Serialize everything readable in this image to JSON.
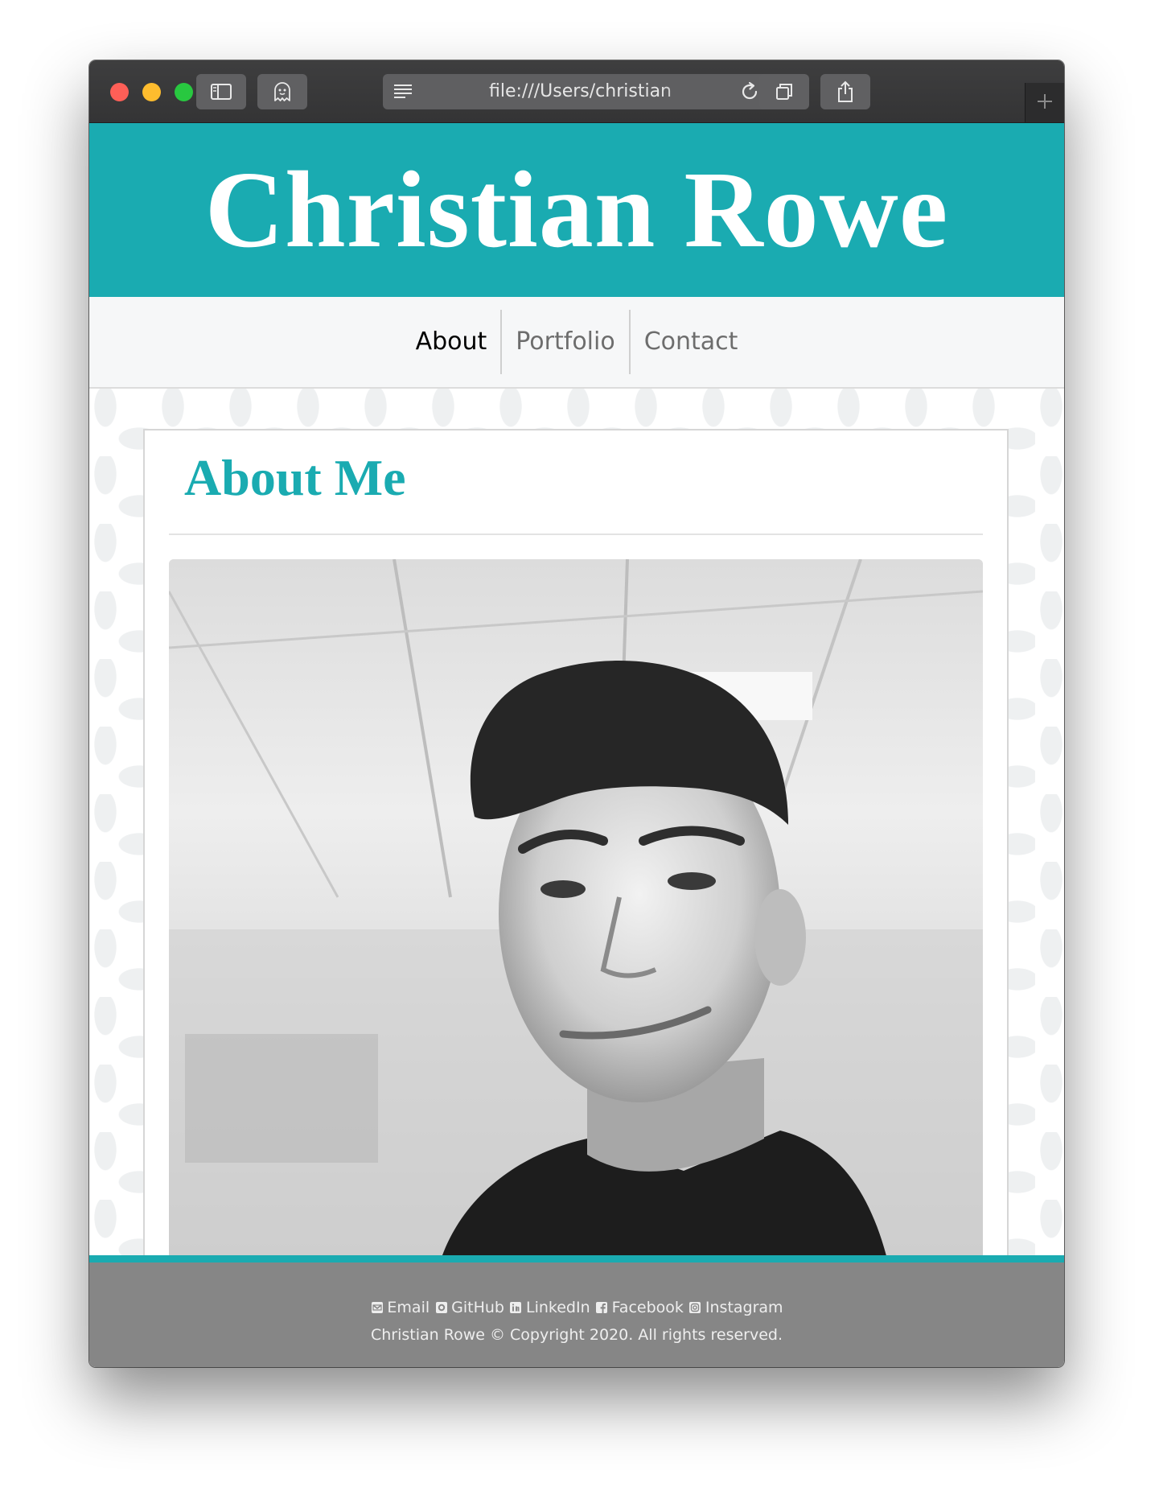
{
  "browser": {
    "url": "file:///Users/christian",
    "buttons": [
      "sidebar",
      "ghostery",
      "reader",
      "reload",
      "tabs-overview",
      "share",
      "new-tab"
    ]
  },
  "site": {
    "title": "Christian Rowe",
    "nav": [
      {
        "label": "About",
        "active": true
      },
      {
        "label": "Portfolio",
        "active": false
      },
      {
        "label": "Contact",
        "active": false
      }
    ],
    "section_title": "About Me",
    "footer": {
      "links": [
        {
          "label": "Email",
          "icon": "envelope-icon"
        },
        {
          "label": "GitHub",
          "icon": "github-icon"
        },
        {
          "label": "LinkedIn",
          "icon": "linkedin-icon"
        },
        {
          "label": "Facebook",
          "icon": "facebook-icon"
        },
        {
          "label": "Instagram",
          "icon": "instagram-icon"
        }
      ],
      "copyright": "Christian Rowe © Copyright 2020. All rights reserved."
    }
  },
  "colors": {
    "accent": "#1aabb1",
    "nav_bg": "#f6f7f8",
    "footer_bg": "#868686",
    "titlebar": "#3a3a3b"
  }
}
